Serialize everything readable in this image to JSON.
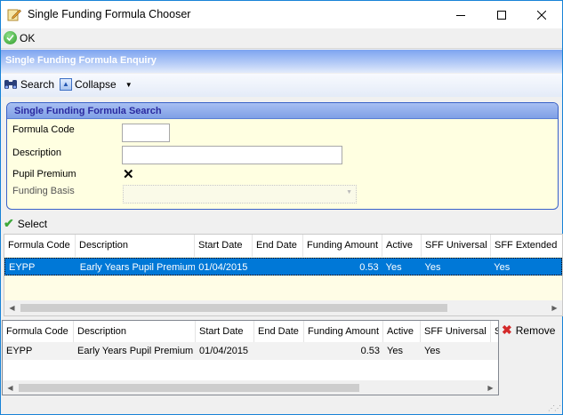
{
  "window": {
    "title": "Single Funding Formula Chooser"
  },
  "okbar": {
    "ok_label": "OK"
  },
  "enquiry": {
    "header": "Single Funding Formula Enquiry"
  },
  "toolbar": {
    "search_label": "Search",
    "collapse_label": "Collapse"
  },
  "search_panel": {
    "title": "Single Funding Formula Search",
    "formula_code_label": "Formula Code",
    "formula_code_value": "",
    "description_label": "Description",
    "description_value": "",
    "pupil_premium_label": "Pupil Premium",
    "pupil_premium_mark": "✕",
    "funding_basis_label": "Funding Basis",
    "funding_basis_value": ""
  },
  "select_bar": {
    "select_label": "Select"
  },
  "results_grid": {
    "columns": [
      "Formula Code",
      "Description",
      "Start Date",
      "End Date",
      "Funding Amount",
      "Active",
      "SFF Universal",
      "SFF Extended"
    ],
    "rows": [
      [
        "EYPP",
        "Early Years Pupil Premium",
        "01/04/2015",
        "",
        "0.53",
        "Yes",
        "Yes",
        "Yes"
      ]
    ]
  },
  "selected_grid": {
    "columns": [
      "Formula Code",
      "Description",
      "Start Date",
      "End Date",
      "Funding Amount",
      "Active",
      "SFF Universal",
      "S"
    ],
    "rows": [
      [
        "EYPP",
        "Early Years Pupil Premium",
        "01/04/2015",
        "",
        "0.53",
        "Yes",
        "Yes",
        ""
      ]
    ]
  },
  "remove": {
    "label": "Remove"
  },
  "colors": {
    "accent": "#0078d7",
    "header_gradient": "#7da4f0",
    "panel_bg": "#ffffe1"
  }
}
